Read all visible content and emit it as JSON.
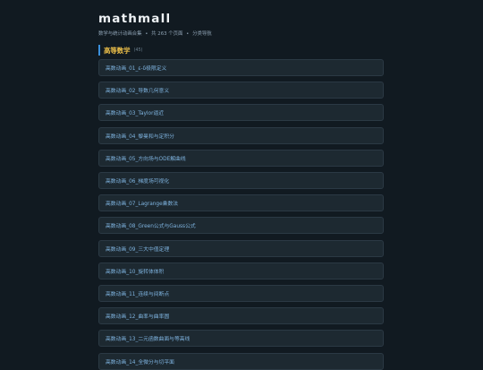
{
  "header": {
    "title": "mathmall",
    "subtitle_parts": [
      "数学与统计动画合集",
      "•",
      "共 263 个页面",
      "•",
      "分类导航"
    ]
  },
  "section": {
    "title": "高等数学",
    "count": "(45)"
  },
  "items": [
    {
      "label": "高数动画_01_ε-δ极限定义"
    },
    {
      "label": "高数动画_02_导数几何意义"
    },
    {
      "label": "高数动画_03_Taylor逼近"
    },
    {
      "label": "高数动画_04_黎曼和与定积分"
    },
    {
      "label": "高数动画_05_方向场与ODE解曲线"
    },
    {
      "label": "高数动画_06_梯度场可视化"
    },
    {
      "label": "高数动画_07_Lagrange乘数法"
    },
    {
      "label": "高数动画_08_Green公式与Gauss公式"
    },
    {
      "label": "高数动画_09_三大中值定理"
    },
    {
      "label": "高数动画_10_旋转体体积"
    },
    {
      "label": "高数动画_11_连续与间断点"
    },
    {
      "label": "高数动画_12_曲率与曲率圆"
    },
    {
      "label": "高数动画_13_二元函数曲面与等高线"
    },
    {
      "label": "高数动画_14_全微分与切平面"
    }
  ],
  "colors": {
    "background": "#111a21",
    "accent_bar": "#3a8fdb",
    "section_title": "#f0c24a",
    "item_text": "#7fb4e0"
  }
}
